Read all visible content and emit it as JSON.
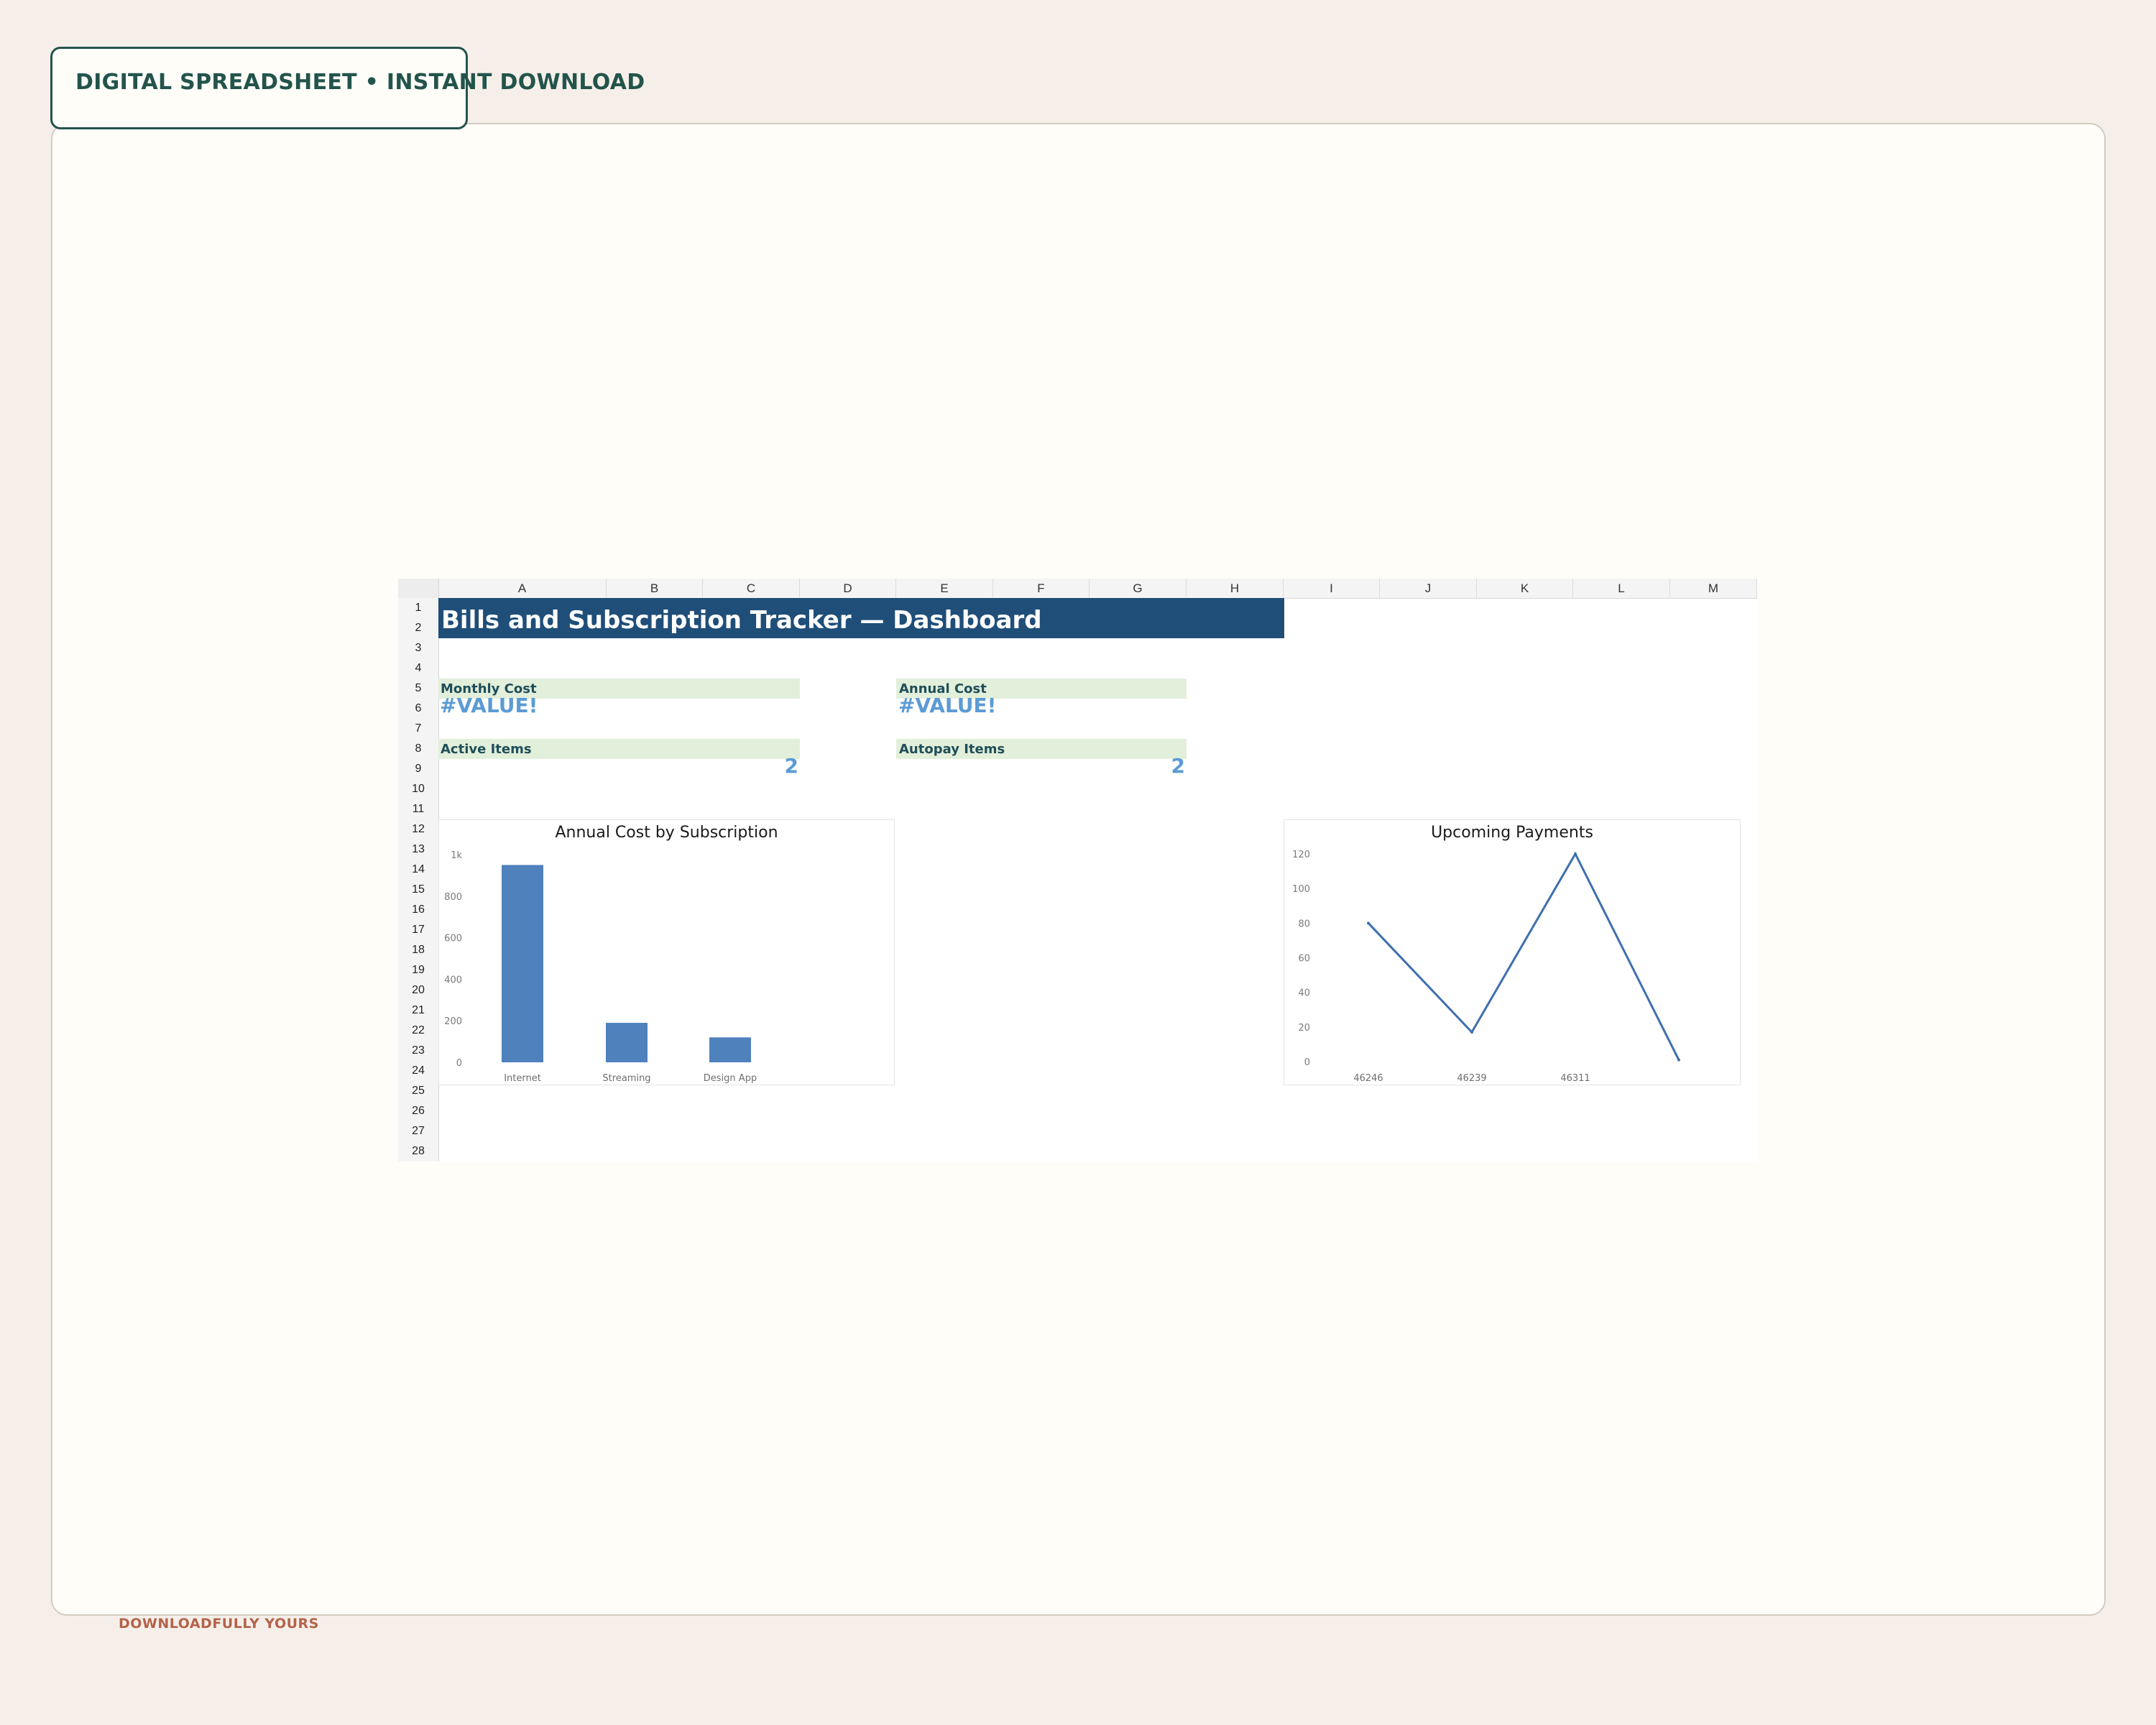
{
  "badge": {
    "text": "DIGITAL SPREADSHEET • INSTANT DOWNLOAD"
  },
  "footer": {
    "brand": "DOWNLOADFULLY YOURS"
  },
  "sheet": {
    "columns": [
      "A",
      "B",
      "C",
      "D",
      "E",
      "F",
      "G",
      "H",
      "I",
      "J",
      "K",
      "L",
      "M"
    ],
    "rows": [
      "1",
      "2",
      "3",
      "4",
      "5",
      "6",
      "7",
      "8",
      "9",
      "10",
      "11",
      "12",
      "13",
      "14",
      "15",
      "16",
      "17",
      "18",
      "19",
      "20",
      "21",
      "22",
      "23",
      "24",
      "25",
      "26",
      "27",
      "28"
    ],
    "title": "Bills and Subscription Tracker — Dashboard",
    "kpis": {
      "monthly_cost": {
        "label": "Monthly Cost",
        "value": "#VALUE!"
      },
      "annual_cost": {
        "label": "Annual Cost",
        "value": "#VALUE!"
      },
      "active_items": {
        "label": "Active Items",
        "value": "2"
      },
      "autopay_items": {
        "label": "Autopay Items",
        "value": "2"
      }
    }
  },
  "colors": {
    "banner": "#1f4e79",
    "kpi_label_bg": "#e2efda",
    "kpi_value": "#5b9bd5",
    "bar": "#4f81bd",
    "line": "#3e6fae"
  },
  "chart_data": [
    {
      "type": "bar",
      "title": "Annual Cost by Subscription",
      "categories": [
        "Internet",
        "Streaming",
        "Design App"
      ],
      "values": [
        950,
        190,
        120
      ],
      "ylim": [
        0,
        1000
      ],
      "yticks": [
        0,
        200,
        400,
        600,
        800,
        1000
      ],
      "ytick_labels": [
        "0",
        "200",
        "400",
        "600",
        "800",
        "1k"
      ],
      "grid": false,
      "legend": "none"
    },
    {
      "type": "line",
      "title": "Upcoming Payments",
      "x_labels": [
        "46246",
        "46239",
        "46311",
        ""
      ],
      "values": [
        80,
        17,
        120,
        1
      ],
      "ylim": [
        0,
        120
      ],
      "yticks": [
        0,
        20,
        40,
        60,
        80,
        100,
        120
      ],
      "grid": false,
      "legend": "none"
    }
  ]
}
